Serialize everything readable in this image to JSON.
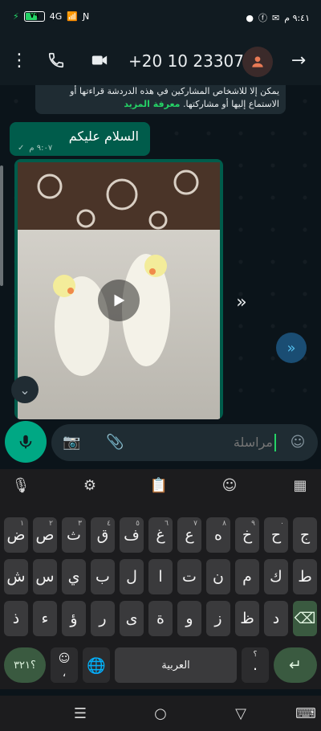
{
  "status_bar": {
    "battery": "٧٩",
    "network": "4G",
    "time": "٩:٤١ م"
  },
  "appbar": {
    "contact": "+20 10 23307...",
    "icons": [
      "more-vert-icon",
      "phone-icon",
      "video-icon",
      "avatar",
      "forward-arrow-icon"
    ]
  },
  "notice": {
    "line1": "يمكن إلا للاشخاص المشاركين في هذه الدردشة قراءتها أو",
    "line2": "الاستماع إليها أو مشاركتها.",
    "more": "معرفة المزيد"
  },
  "message": {
    "text": "السلام عليكم",
    "time": "٩:٠٧ م"
  },
  "compose": {
    "placeholder": "مراسلة"
  },
  "keyboard": {
    "row1": [
      {
        "k": "ض",
        "h": "١"
      },
      {
        "k": "ص",
        "h": "٢"
      },
      {
        "k": "ث",
        "h": "٣"
      },
      {
        "k": "ق",
        "h": "٤"
      },
      {
        "k": "ف",
        "h": "٥"
      },
      {
        "k": "غ",
        "h": "٦"
      },
      {
        "k": "ع",
        "h": "٧"
      },
      {
        "k": "ه",
        "h": "٨"
      },
      {
        "k": "خ",
        "h": "٩"
      },
      {
        "k": "ح",
        "h": "٠"
      },
      {
        "k": "ج",
        "h": ""
      }
    ],
    "row2": [
      "ش",
      "س",
      "ي",
      "ب",
      "ل",
      "ا",
      "ت",
      "ن",
      "م",
      "ك",
      "ط"
    ],
    "row3": [
      "ذ",
      "ء",
      "ؤ",
      "ر",
      "ى",
      "ة",
      "و",
      "ز",
      "ظ",
      "د"
    ],
    "symbols": "؟٣٢١",
    "emoji_hint": "،",
    "space": "العربية",
    "period": ".",
    "period_hint": "؟"
  }
}
